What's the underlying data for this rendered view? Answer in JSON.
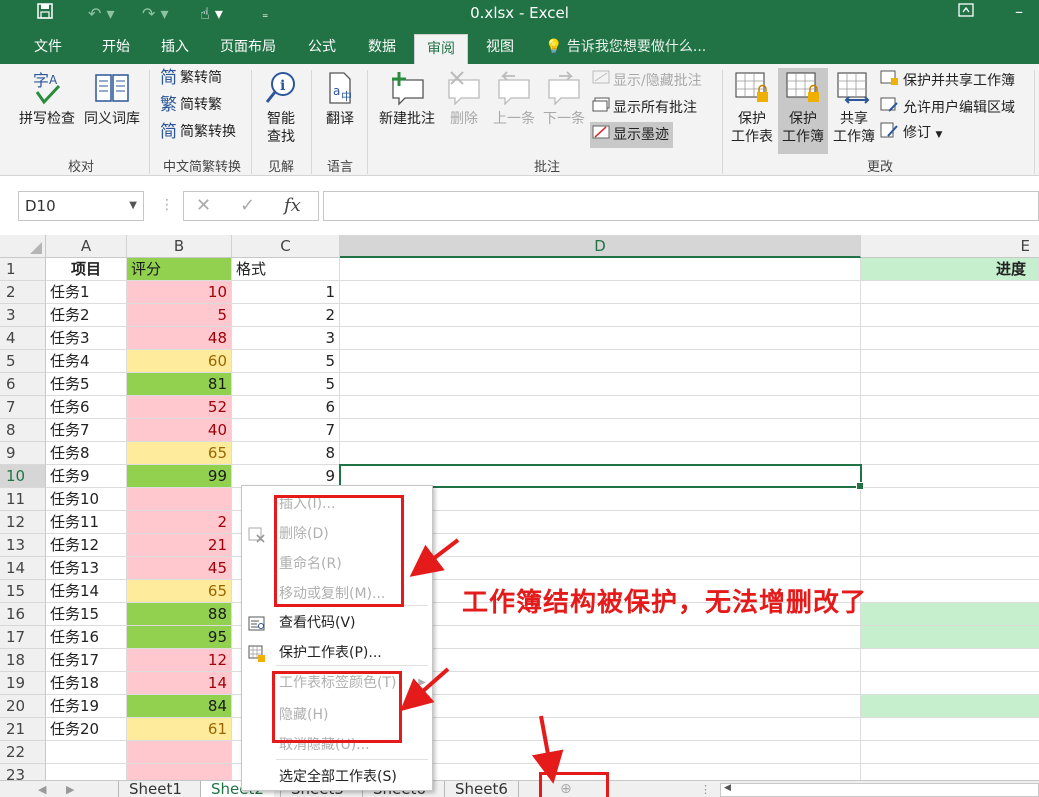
{
  "titlebar": {
    "title": "0.xlsx - Excel",
    "bg_color": "#217346",
    "qat_icons": [
      "save-icon",
      "undo-icon",
      "redo-icon",
      "touch-mode-icon",
      "customize-icon"
    ]
  },
  "tabs": [
    "文件",
    "开始",
    "插入",
    "页面布局",
    "公式",
    "数据",
    "审阅",
    "视图"
  ],
  "active_tab": "审阅",
  "tell_me": "告诉我您想要做什么...",
  "ribbon": {
    "proofing": {
      "spelling": "拼写检查",
      "thesaurus": "同义词库",
      "label": "校对"
    },
    "chinese_conversion": {
      "to_simplified": "繁转简",
      "to_traditional": "简转繁",
      "convert": "简繁转换",
      "label": "中文简繁转换"
    },
    "insights": {
      "smart_lookup_line1": "智能",
      "smart_lookup_line2": "查找",
      "label": "见解"
    },
    "language": {
      "translate": "翻译",
      "label": "语言"
    },
    "comments": {
      "new_comment": "新建批注",
      "delete": "删除",
      "previous": "上一条",
      "next": "下一条",
      "show_hide": "显示/隐藏批注",
      "show_all": "显示所有批注",
      "show_ink": "显示墨迹",
      "label": "批注"
    },
    "changes": {
      "protect_sheet_1": "保护",
      "protect_sheet_2": "工作表",
      "protect_workbook_1": "保护",
      "protect_workbook_2": "工作簿",
      "share_1": "共享",
      "share_2": "工作簿",
      "protect_share": "保护并共享工作簿",
      "allow_edit": "允许用户编辑区域",
      "track_changes": "修订",
      "label": "更改"
    }
  },
  "formula_bar": {
    "name_box": "D10",
    "fx": "fx",
    "value": ""
  },
  "columns": [
    "A",
    "B",
    "C",
    "D",
    "E"
  ],
  "row_numbers": [
    "1",
    "2",
    "3",
    "4",
    "5",
    "6",
    "7",
    "8",
    "9",
    "10",
    "11",
    "12",
    "13",
    "14",
    "15",
    "16",
    "17",
    "18",
    "19",
    "20",
    "21",
    "22",
    "23"
  ],
  "rows": [
    {
      "a": "项目",
      "b": "评分",
      "c": "格式",
      "e": "进度",
      "b_fill": "green"
    },
    {
      "a": "任务1",
      "b": "10",
      "c": "1",
      "b_fill": "red"
    },
    {
      "a": "任务2",
      "b": "5",
      "c": "2",
      "b_fill": "red"
    },
    {
      "a": "任务3",
      "b": "48",
      "c": "3",
      "b_fill": "red"
    },
    {
      "a": "任务4",
      "b": "60",
      "c": "5",
      "b_fill": "yellow"
    },
    {
      "a": "任务5",
      "b": "81",
      "c": "5",
      "b_fill": "green"
    },
    {
      "a": "任务6",
      "b": "52",
      "c": "6",
      "b_fill": "red"
    },
    {
      "a": "任务7",
      "b": "40",
      "c": "7",
      "b_fill": "red"
    },
    {
      "a": "任务8",
      "b": "65",
      "c": "8",
      "b_fill": "yellow"
    },
    {
      "a": "任务9",
      "b": "99",
      "c": "9",
      "b_fill": "green"
    },
    {
      "a": "任务10",
      "b": "",
      "c": "",
      "b_fill": "red"
    },
    {
      "a": "任务11",
      "b": "2",
      "c": "",
      "b_fill": "red"
    },
    {
      "a": "任务12",
      "b": "21",
      "c": "",
      "b_fill": "red"
    },
    {
      "a": "任务13",
      "b": "45",
      "c": "",
      "b_fill": "red"
    },
    {
      "a": "任务14",
      "b": "65",
      "c": "",
      "b_fill": "yellow"
    },
    {
      "a": "任务15",
      "b": "88",
      "c": "",
      "b_fill": "green",
      "e_fill": "lightgreen"
    },
    {
      "a": "任务16",
      "b": "95",
      "c": "",
      "b_fill": "green",
      "e_fill": "lightgreen"
    },
    {
      "a": "任务17",
      "b": "12",
      "c": "",
      "b_fill": "red"
    },
    {
      "a": "任务18",
      "b": "14",
      "c": "",
      "b_fill": "red"
    },
    {
      "a": "任务19",
      "b": "84",
      "c": "",
      "b_fill": "green",
      "e_fill": "lightgreen"
    },
    {
      "a": "任务20",
      "b": "61",
      "c": "",
      "b_fill": "yellow"
    },
    {
      "a": "",
      "b": "",
      "c": "",
      "b_fill": "red"
    },
    {
      "a": "",
      "b": "",
      "c": "",
      "b_fill": "red"
    }
  ],
  "selected_cell": "D10",
  "sheet_tabs": [
    "Sheet1",
    "Sheet2",
    "Sheet3",
    "Sheet6",
    "Sheet6"
  ],
  "active_sheet": "Sheet2",
  "context_menu": {
    "items": [
      {
        "label": "插入(I)...",
        "disabled": true,
        "icon": ""
      },
      {
        "label": "删除(D)",
        "disabled": true,
        "icon": "delete-sheet-icon"
      },
      {
        "label": "重命名(R)",
        "disabled": true,
        "icon": ""
      },
      {
        "label": "移动或复制(M)...",
        "disabled": true,
        "icon": ""
      },
      {
        "label": "查看代码(V)",
        "disabled": false,
        "icon": "view-code-icon"
      },
      {
        "label": "保护工作表(P)...",
        "disabled": false,
        "icon": "protect-sheet-icon"
      },
      {
        "label": "工作表标签颜色(T)",
        "disabled": true,
        "icon": "",
        "submenu": true
      },
      {
        "label": "隐藏(H)",
        "disabled": true,
        "icon": ""
      },
      {
        "label": "取消隐藏(U)...",
        "disabled": true,
        "icon": ""
      },
      {
        "label": "选定全部工作表(S)",
        "disabled": false,
        "icon": ""
      }
    ]
  },
  "annotation": {
    "text": "工作簿结构被保护，无法增删改了",
    "color": "#e51b1b"
  },
  "colors": {
    "excel_green": "#217346",
    "fill_red": "#ffc7ce",
    "fill_yellow": "#ffeb9c",
    "fill_green": "#92d050",
    "fill_lightgreen": "#c6efce"
  }
}
